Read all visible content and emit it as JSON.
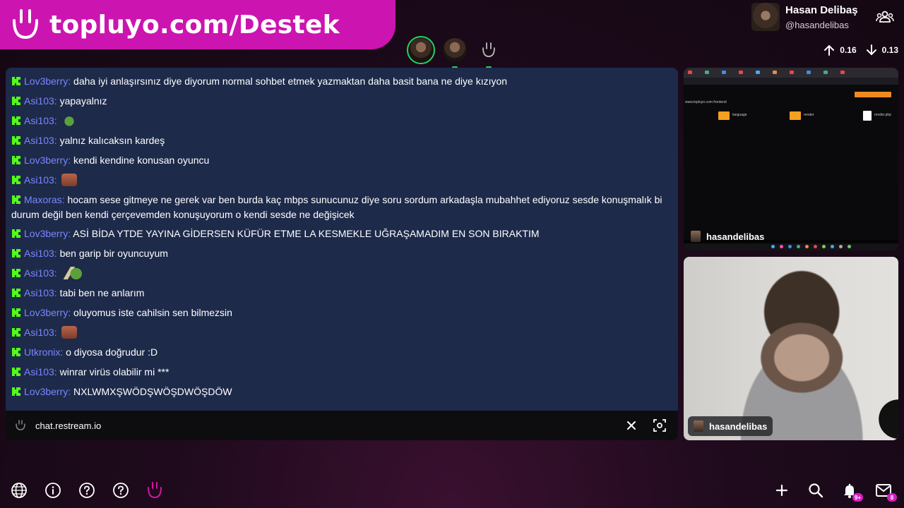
{
  "banner": {
    "text": "topluyo.com/Destek"
  },
  "profile": {
    "name": "Hasan Delibaş",
    "handle": "@hasandelibas"
  },
  "stats": {
    "up": "0.16",
    "down": "0.13"
  },
  "chat": {
    "messages": [
      {
        "user": "Lov3berry:",
        "text": "daha iyi anlaşırsınız diye diyorum normal sohbet etmek yazmaktan daha basit bana ne diye kızıyon",
        "emote": ""
      },
      {
        "user": "Asi103:",
        "text": "yapayalnız",
        "emote": ""
      },
      {
        "user": "Asi103:",
        "text": "",
        "emote": "pepe"
      },
      {
        "user": "Asi103:",
        "text": "yalnız kalıcaksın kardeş",
        "emote": ""
      },
      {
        "user": "Lov3berry:",
        "text": "kendi kendine konusan oyuncu",
        "emote": ""
      },
      {
        "user": "Asi103:",
        "text": "",
        "emote": "face"
      },
      {
        "user": "Maxoras:",
        "text": "hocam sese gitmeye ne gerek var ben burda kaç mbps sunucunuz diye soru sordum arkadaşla mubahhet ediyoruz sesde konuşmalık bi durum değil ben kendi çerçevemden konuşuyorum o kendi sesde ne değişicek",
        "emote": ""
      },
      {
        "user": "Lov3berry:",
        "text": "ASİ BİDA YTDE YAYINA GİDERSEN KÜFÜR ETME LA KESMEKLE UĞRAŞAMADIM EN SON BIRAKTIM",
        "emote": ""
      },
      {
        "user": "Asi103:",
        "text": "ben garip bir oyuncuyum",
        "emote": ""
      },
      {
        "user": "Asi103:",
        "text": "",
        "emote": "pepe2"
      },
      {
        "user": "Asi103:",
        "text": "tabi ben ne anlarım",
        "emote": ""
      },
      {
        "user": "Lov3berry:",
        "text": "oluyomus iste cahilsin sen bilmezsin",
        "emote": ""
      },
      {
        "user": "Asi103:",
        "text": "",
        "emote": "face"
      },
      {
        "user": "Utkronix:",
        "text": "o diyosa doğrudur :D",
        "emote": ""
      },
      {
        "user": "Asi103:",
        "text": "winrar virüs olabilir mi ***",
        "emote": ""
      },
      {
        "user": "Lov3berry:",
        "text": "NXLWMXŞWÖDŞWÖŞDWÖŞDÖW",
        "emote": ""
      }
    ],
    "source": "chat.restream.io"
  },
  "screen_share": {
    "owner": "hasandelibas",
    "breadcrumb": "www.topluyo.com   frontend",
    "items": [
      "language",
      "render",
      "render.php"
    ]
  },
  "camera": {
    "owner": "hasandelibas"
  },
  "notifications": {
    "bell_badge": "9+",
    "mail_badge": "8"
  },
  "colors": {
    "banner": "#cc14b0",
    "chat_bg": "#1d2a4a",
    "kick_green": "#53fc18",
    "active_ring": "#1ed760"
  }
}
